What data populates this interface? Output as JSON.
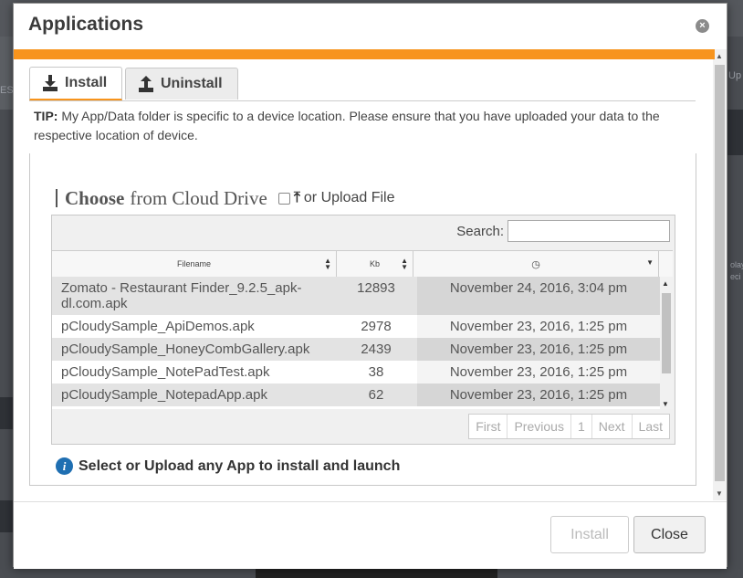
{
  "background": {
    "left_fragment": "ES",
    "right_fragment_1": "Up",
    "right_fragment_2": "olay",
    "right_fragment_3": "eci"
  },
  "modal": {
    "title": "Applications",
    "close_icon": "close-icon",
    "accent_color": "#f7941d"
  },
  "tabs": [
    {
      "label": "Install",
      "icon": "download-icon",
      "active": true
    },
    {
      "label": "Uninstall",
      "icon": "upload-icon",
      "active": false
    }
  ],
  "tip": {
    "label": "TIP:",
    "text": " My App/Data folder is specific to a device location. Please ensure that you have uploaded your data to the respective location of device."
  },
  "chooser": {
    "choose_strong": "Choose",
    "choose_rest": "from Cloud Drive",
    "upload_label": "or Upload File"
  },
  "table": {
    "search_label": "Search:",
    "search_value": "",
    "columns": [
      "Filename",
      "Kb",
      "clock-icon"
    ],
    "rows": [
      {
        "filename": "Zomato - Restaurant Finder_9.2.5_apk-dl.com.apk",
        "kb": "12893",
        "date": "November 24, 2016, 3:04 pm"
      },
      {
        "filename": "pCloudySample_ApiDemos.apk",
        "kb": "2978",
        "date": "November 23, 2016, 1:25 pm"
      },
      {
        "filename": "pCloudySample_HoneyCombGallery.apk",
        "kb": "2439",
        "date": "November 23, 2016, 1:25 pm"
      },
      {
        "filename": "pCloudySample_NotePadTest.apk",
        "kb": "38",
        "date": "November 23, 2016, 1:25 pm"
      },
      {
        "filename": "pCloudySample_NotepadApp.apk",
        "kb": "62",
        "date": "November 23, 2016, 1:25 pm"
      }
    ],
    "pager": [
      "First",
      "Previous",
      "1",
      "Next",
      "Last"
    ]
  },
  "hint": {
    "text": "Select or Upload any App to install and launch"
  },
  "footer": {
    "install_label": "Install",
    "close_label": "Close"
  }
}
